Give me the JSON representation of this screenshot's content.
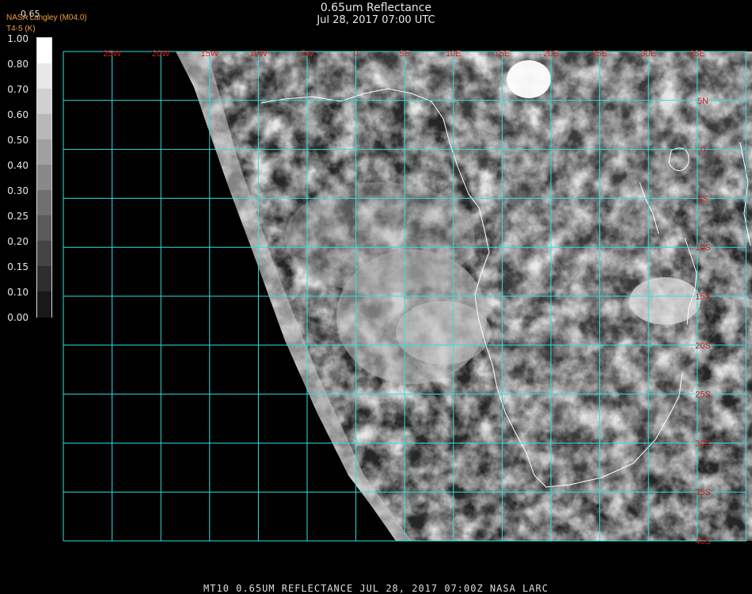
{
  "header": {
    "title": "0.65um Reflectance",
    "datetime": "Jul 28, 2017 07:00 UTC",
    "credit": "NASA Langley (M04.0)",
    "credit_sub": "T4-5 (K)",
    "scale_top": "0.65"
  },
  "legend": {
    "labels": [
      "1.00",
      "0.80",
      "0.70",
      "0.60",
      "0.50",
      "0.40",
      "0.30",
      "0.25",
      "0.20",
      "0.15",
      "0.10",
      "0.00"
    ]
  },
  "map": {
    "lon_labels": [
      "25W",
      "20W",
      "15W",
      "10W",
      "5W",
      "0",
      "5E",
      "10E",
      "15E",
      "20E",
      "25E",
      "30E",
      "35E"
    ],
    "lat_labels": [
      "5N",
      "0",
      "5S",
      "10S",
      "15S",
      "20S",
      "25S",
      "30S",
      "35S",
      "40S"
    ],
    "colors": {
      "grid": "#2fe0e0",
      "grid_label": "#d21e1e",
      "coast": "#ffffff",
      "background": "#000000"
    }
  },
  "footer": {
    "text": "MT10  0.65UM REFLECTANCE   JUL 28, 2017 07:00Z   NASA LARC"
  }
}
